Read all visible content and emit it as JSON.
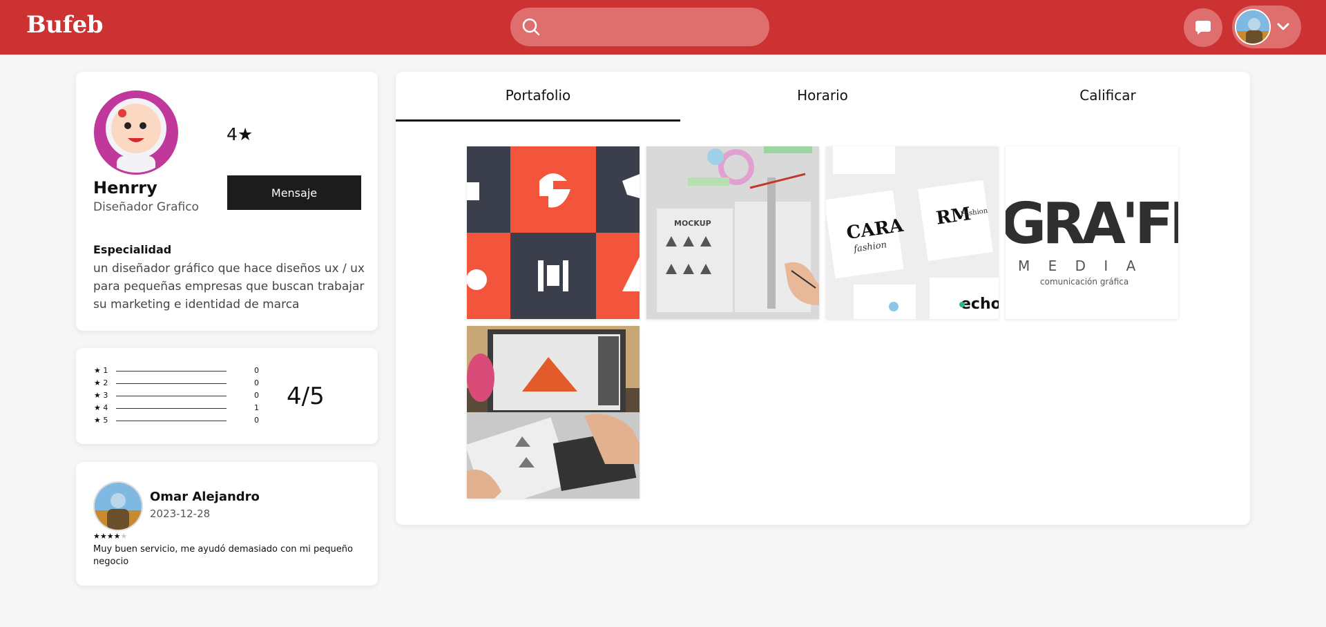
{
  "header": {
    "brand": "Bufeb",
    "search": {
      "placeholder": "",
      "value": "",
      "icon": "search-icon"
    },
    "chat_icon": "chat-icon",
    "menu_icon": "chevron-down-icon",
    "colors": {
      "bar": "#cd3233",
      "pill": "#df6e6e"
    }
  },
  "profile": {
    "name": "Henrry",
    "role": "Diseñador Grafico",
    "rating": "4★",
    "message_label": "Mensaje",
    "specialty_title": "Especialidad",
    "specialty_text": "un diseñador gráfico que hace diseños ux / ux para pequeñas empresas que buscan trabajar su marketing e identidad de marca"
  },
  "ratings": {
    "rows": [
      {
        "label": "★ 1",
        "count": "0"
      },
      {
        "label": "★ 2",
        "count": "0"
      },
      {
        "label": "★ 3",
        "count": "0"
      },
      {
        "label": "★ 4",
        "count": "1"
      },
      {
        "label": "★ 5",
        "count": "0"
      }
    ],
    "summary": "4/5"
  },
  "review": {
    "name": "Omar Alejandro",
    "date": "2023-12-28",
    "stars_filled": "★★★★",
    "stars_empty": "★",
    "stars_value": 4,
    "text": "Muy buen servicio, me ayudó demasiado con mi pequeño negocio"
  },
  "tabs": [
    {
      "label": "Portafolio",
      "active": true
    },
    {
      "label": "Horario",
      "active": false
    },
    {
      "label": "Calificar",
      "active": false
    }
  ],
  "portfolio": {
    "tiles": [
      {
        "kind": "logo-grid"
      },
      {
        "kind": "mockup-photo",
        "text": "MOCKUP"
      },
      {
        "kind": "fashion-cards",
        "text1": "CARA",
        "text2": "fashion",
        "text3": "RM",
        "text4": "Fashion",
        "text5": "echo"
      },
      {
        "kind": "grafica-logo",
        "text1": "GRA'FIC",
        "text2": "M E D I A",
        "text3": "comunicación gráfica"
      },
      {
        "kind": "designer-photo"
      }
    ]
  }
}
